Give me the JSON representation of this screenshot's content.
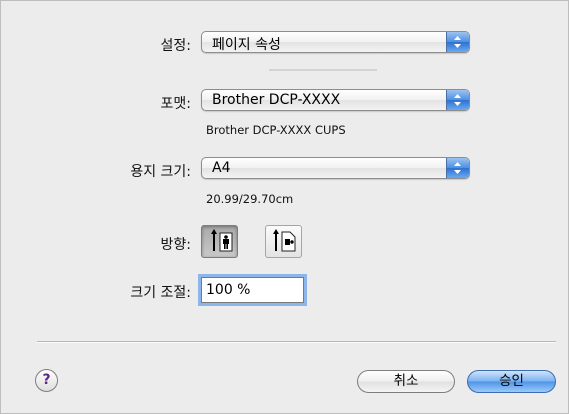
{
  "settings": {
    "label": "설정:",
    "value": "페이지 속성"
  },
  "format": {
    "label": "포맷:",
    "value": "Brother DCP-XXXX",
    "description": "Brother DCP-XXXX CUPS"
  },
  "paper_size": {
    "label": "용지 크기:",
    "value": "A4",
    "dimensions": "20.99/29.70cm"
  },
  "orientation": {
    "label": "방향:",
    "selected": "portrait",
    "options": [
      "portrait-icon",
      "landscape-icon"
    ]
  },
  "scale": {
    "label": "크기 조절:",
    "value": "100 %"
  },
  "buttons": {
    "help": "?",
    "cancel": "취소",
    "ok": "승인"
  },
  "colors": {
    "accent": "#4f93e6",
    "focus_ring": "#8cb6e9"
  }
}
